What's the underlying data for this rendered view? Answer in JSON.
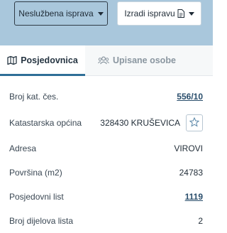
{
  "header": {
    "unofficial_button_label": "Neslužbena isprava",
    "create_button_label": "Izradi ispravu"
  },
  "tabs": [
    {
      "label": "Posjedovnica",
      "active": true,
      "icon": "map-icon"
    },
    {
      "label": "Upisane osobe",
      "active": false,
      "icon": "users-icon"
    }
  ],
  "details": {
    "cadastral_number": {
      "label": "Broj kat. čes.",
      "value": "556/10"
    },
    "cadastral_municipality": {
      "label": "Katastarska općina",
      "value": "328430 KRUŠEVICA"
    },
    "address": {
      "label": "Adresa",
      "value": "VIROVI"
    },
    "area": {
      "label": "Površina (m2)",
      "value": "24783"
    },
    "possession_list": {
      "label": "Posjedovni list",
      "value": "1119"
    },
    "cut_row": {
      "label": "Broj dijelova lista",
      "value": "2"
    }
  },
  "colors": {
    "header_bg": "#a9c7dc",
    "accent": "#2f6f97",
    "link": "#2a4e6c"
  }
}
